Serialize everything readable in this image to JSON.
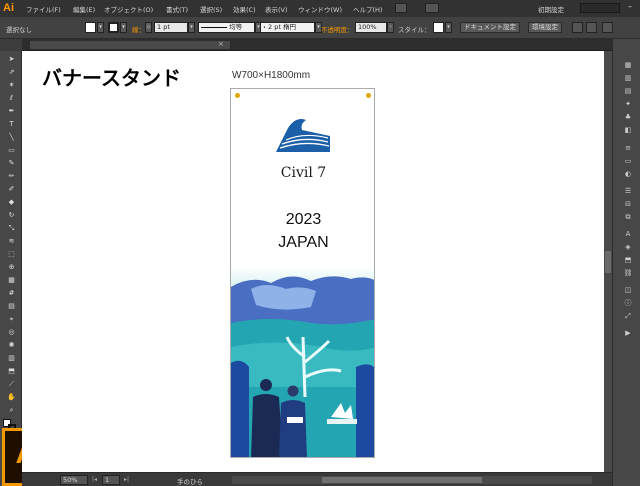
{
  "app": {
    "logo_text": "Ai",
    "workspace": "初期設定"
  },
  "menu": [
    "ファイル(F)",
    "編集(E)",
    "オブジェクト(O)",
    "書式(T)",
    "選択(S)",
    "効果(C)",
    "表示(V)",
    "ウィンドウ(W)",
    "ヘルプ(H)"
  ],
  "control_bar": {
    "selection_label": "選択なし",
    "stroke_label": "線：",
    "stroke_weight": "1 pt",
    "stroke_style": "均等",
    "brush": "2 pt 楕円",
    "opacity_label": "不透明度：",
    "opacity_value": "100%",
    "style_label": "スタイル：",
    "document_setup_button": "ドキュメント設定",
    "preferences_button": "環境設定"
  },
  "status": {
    "zoom": "50%",
    "page": "1",
    "tool": "手のひら"
  },
  "artboard": {
    "heading": "バナースタンド",
    "dimensions": "W700×H1800mm",
    "brand": "Civil 7",
    "year": "2023",
    "country": "JAPAN"
  },
  "icons": [
    "selection-tool",
    "direct-selection-tool",
    "magic-wand-tool",
    "lasso-tool",
    "pen-tool",
    "type-tool",
    "line-tool",
    "rectangle-tool",
    "paintbrush-tool",
    "pencil-tool",
    "blob-brush-tool",
    "eraser-tool",
    "rotate-tool",
    "scale-tool",
    "width-tool",
    "free-transform-tool",
    "shape-builder-tool",
    "perspective-grid-tool",
    "mesh-tool",
    "gradient-tool",
    "eyedropper-tool",
    "blend-tool",
    "symbol-sprayer-tool",
    "column-graph-tool",
    "artboard-tool",
    "slice-tool",
    "hand-tool",
    "zoom-tool"
  ],
  "colors": {
    "accent": "#f39800",
    "brand_blue": "#1a5fa8",
    "teal": "#2fb3b8",
    "navy": "#1b2a55"
  }
}
